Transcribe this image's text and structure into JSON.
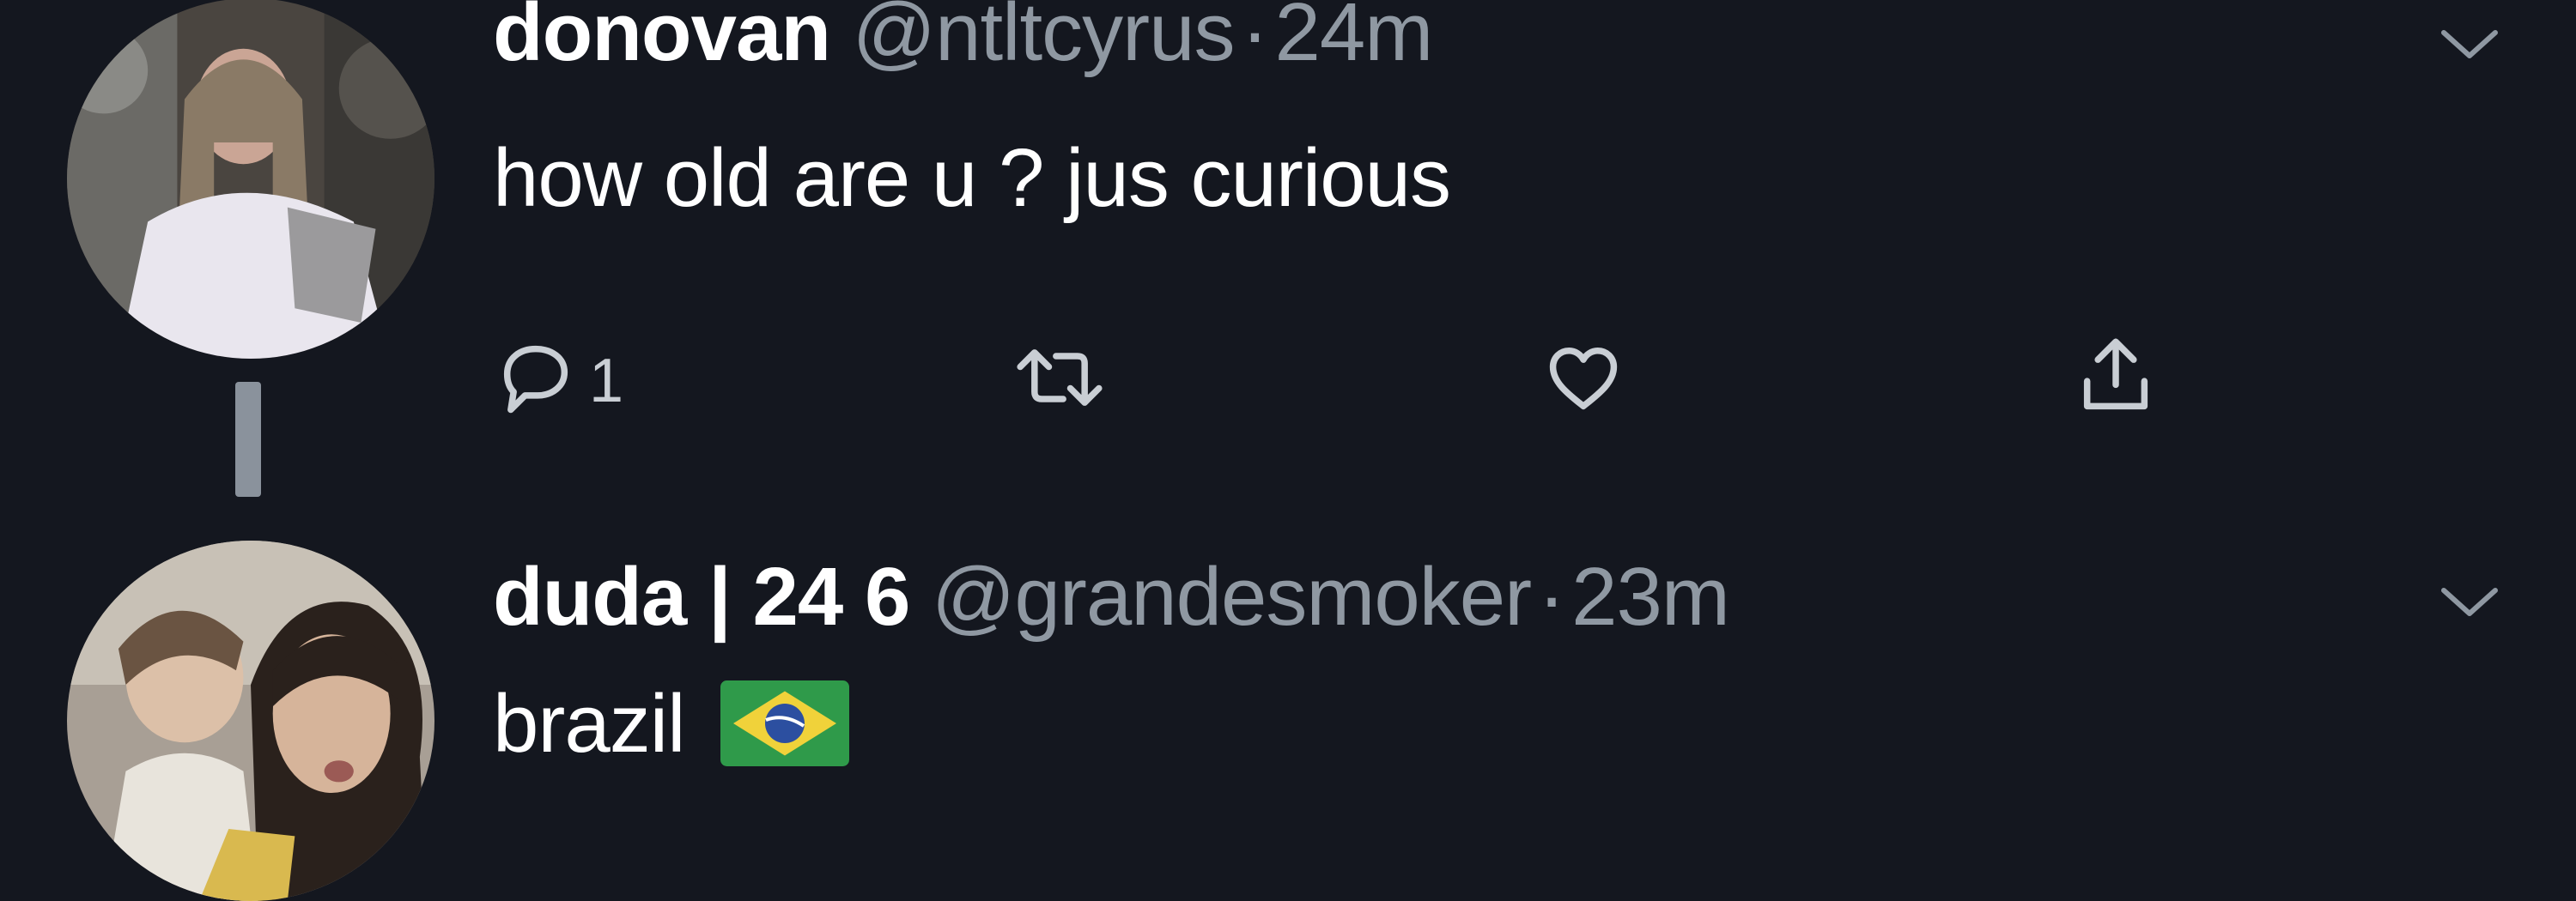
{
  "tweets": [
    {
      "name": "donovan",
      "handle": "@ntltcyrus",
      "separator": "·",
      "time": "24m",
      "text": "how old are u ? jus curious",
      "reply_count": "1",
      "has_thread_line": true
    },
    {
      "name": "duda | 24 6",
      "handle": "@grandesmoker",
      "separator": "·",
      "time": "23m",
      "text": "brazil",
      "emoji": "brazil-flag"
    }
  ],
  "icons": {
    "reply": "speech-bubble-icon",
    "retweet": "retweet-icon",
    "like": "heart-icon",
    "share": "share-icon",
    "menu": "chevron-down-icon"
  },
  "colors": {
    "background": "#14171f",
    "name": "#ffffff",
    "handle": "#8f98a2",
    "icon": "#c9ced4",
    "thread_line": "#8a929c"
  }
}
